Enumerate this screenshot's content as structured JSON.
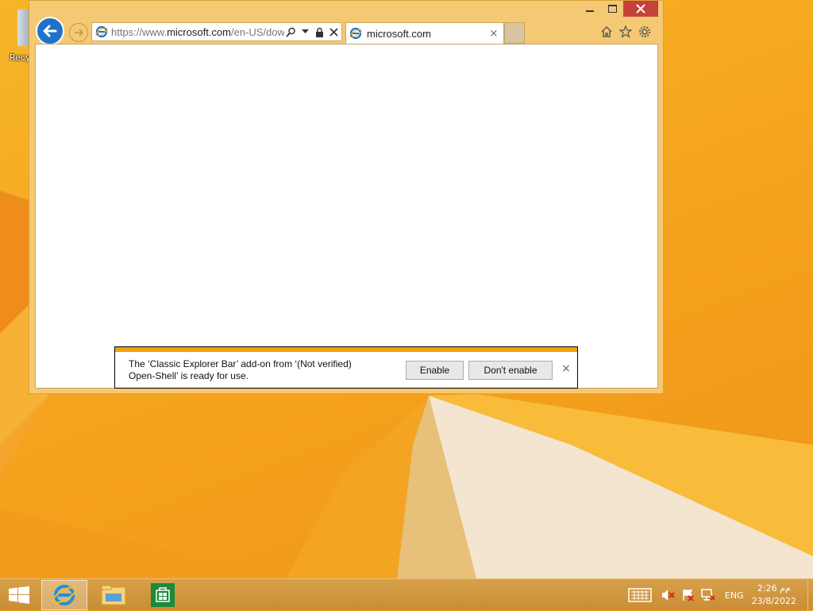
{
  "desktop": {
    "recycle_label": "Recyc"
  },
  "browser": {
    "address": {
      "url_prefix": "https://www.",
      "url_domain": "microsoft.com",
      "url_rest": "/en-US/down"
    },
    "tab": {
      "title": "microsoft.com",
      "close": "×"
    }
  },
  "notification": {
    "message_line1": "The ‘Classic Explorer Bar’ add-on from ‘(Not verified)",
    "message_line2": "Open-Shell’ is ready for use.",
    "enable_label": "Enable",
    "dont_enable_label": "Don't enable",
    "close": "×"
  },
  "taskbar": {
    "language": "ENG",
    "time": "2:26 ﻡﻡ",
    "date": "23/8/2022"
  },
  "colors": {
    "accent": "#f0a30a",
    "window_frame": "#f5c873",
    "close_button": "#c7413a",
    "back_button": "#1e73c8"
  },
  "icons": [
    "recycle-bin-icon",
    "back-arrow-icon",
    "forward-arrow-icon",
    "ie-icon",
    "search-icon",
    "dropdown-icon",
    "lock-icon",
    "stop-icon",
    "home-icon",
    "favorites-star-icon",
    "settings-gear-icon",
    "windows-start-icon",
    "file-explorer-icon",
    "store-icon",
    "keyboard-icon",
    "volume-muted-icon",
    "action-center-flag-icon",
    "network-icon"
  ]
}
